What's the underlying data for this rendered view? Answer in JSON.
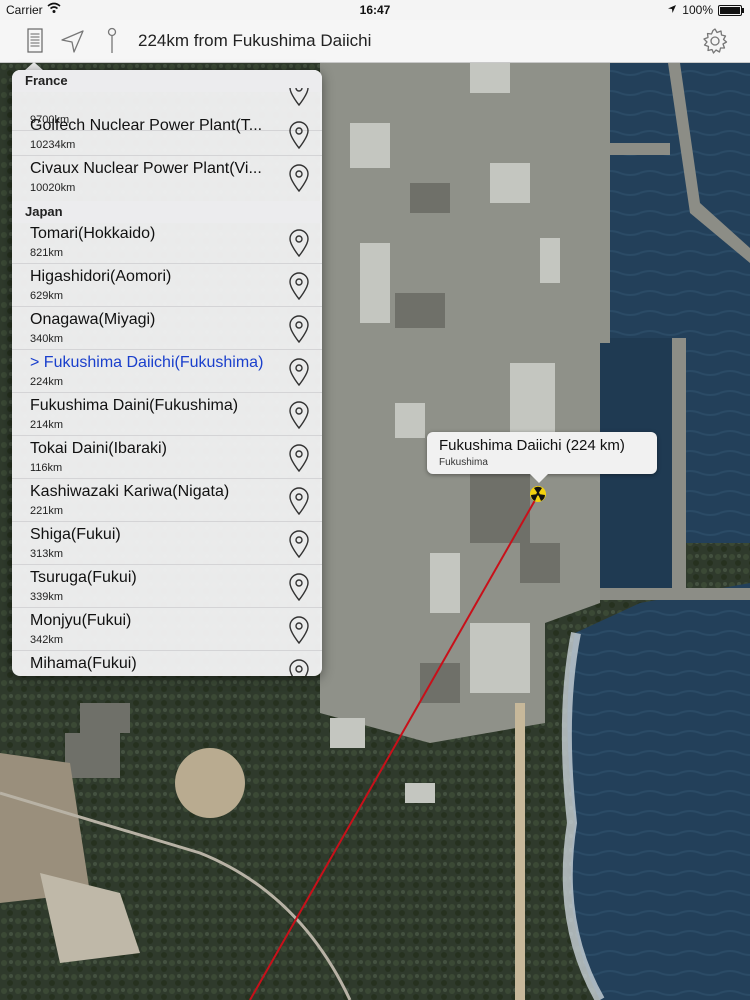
{
  "status": {
    "carrier": "Carrier",
    "time": "16:47",
    "battery": "100%",
    "battery_level": 1.0
  },
  "toolbar": {
    "title": "224km from Fukushima Daiichi",
    "icons": [
      "list-icon",
      "location-arrow-icon",
      "pin-icon",
      "gear-icon"
    ]
  },
  "list": {
    "sections": [
      {
        "header": "France",
        "rows": [
          {
            "name": "",
            "distance": "9700km"
          },
          {
            "name": "Golfech Nuclear Power Plant(T...",
            "distance": "10234km"
          },
          {
            "name": "Civaux Nuclear Power Plant(Vi...",
            "distance": "10020km"
          }
        ]
      },
      {
        "header": "Japan",
        "rows": [
          {
            "name": "Tomari(Hokkaido)",
            "distance": "821km"
          },
          {
            "name": "Higashidori(Aomori)",
            "distance": "629km"
          },
          {
            "name": "Onagawa(Miyagi)",
            "distance": "340km"
          },
          {
            "name": "> Fukushima Daiichi(Fukushima)",
            "distance": "224km",
            "selected": true
          },
          {
            "name": "Fukushima Daini(Fukushima)",
            "distance": "214km"
          },
          {
            "name": "Tokai Daini(Ibaraki)",
            "distance": "116km"
          },
          {
            "name": "Kashiwazaki Kariwa(Nigata)",
            "distance": "221km"
          },
          {
            "name": "Shiga(Fukui)",
            "distance": "313km"
          },
          {
            "name": "Tsuruga(Fukui)",
            "distance": "339km"
          },
          {
            "name": "Monjyu(Fukui)",
            "distance": "342km"
          },
          {
            "name": "Mihama(Fukui)",
            "distance": ""
          }
        ]
      }
    ]
  },
  "callout": {
    "title": "Fukushima Daiichi (224 km)",
    "subtitle": "Fukushima"
  },
  "colors": {
    "selected_text": "#1a3fcc",
    "line": "#c8101a",
    "sea": "#21415a"
  }
}
